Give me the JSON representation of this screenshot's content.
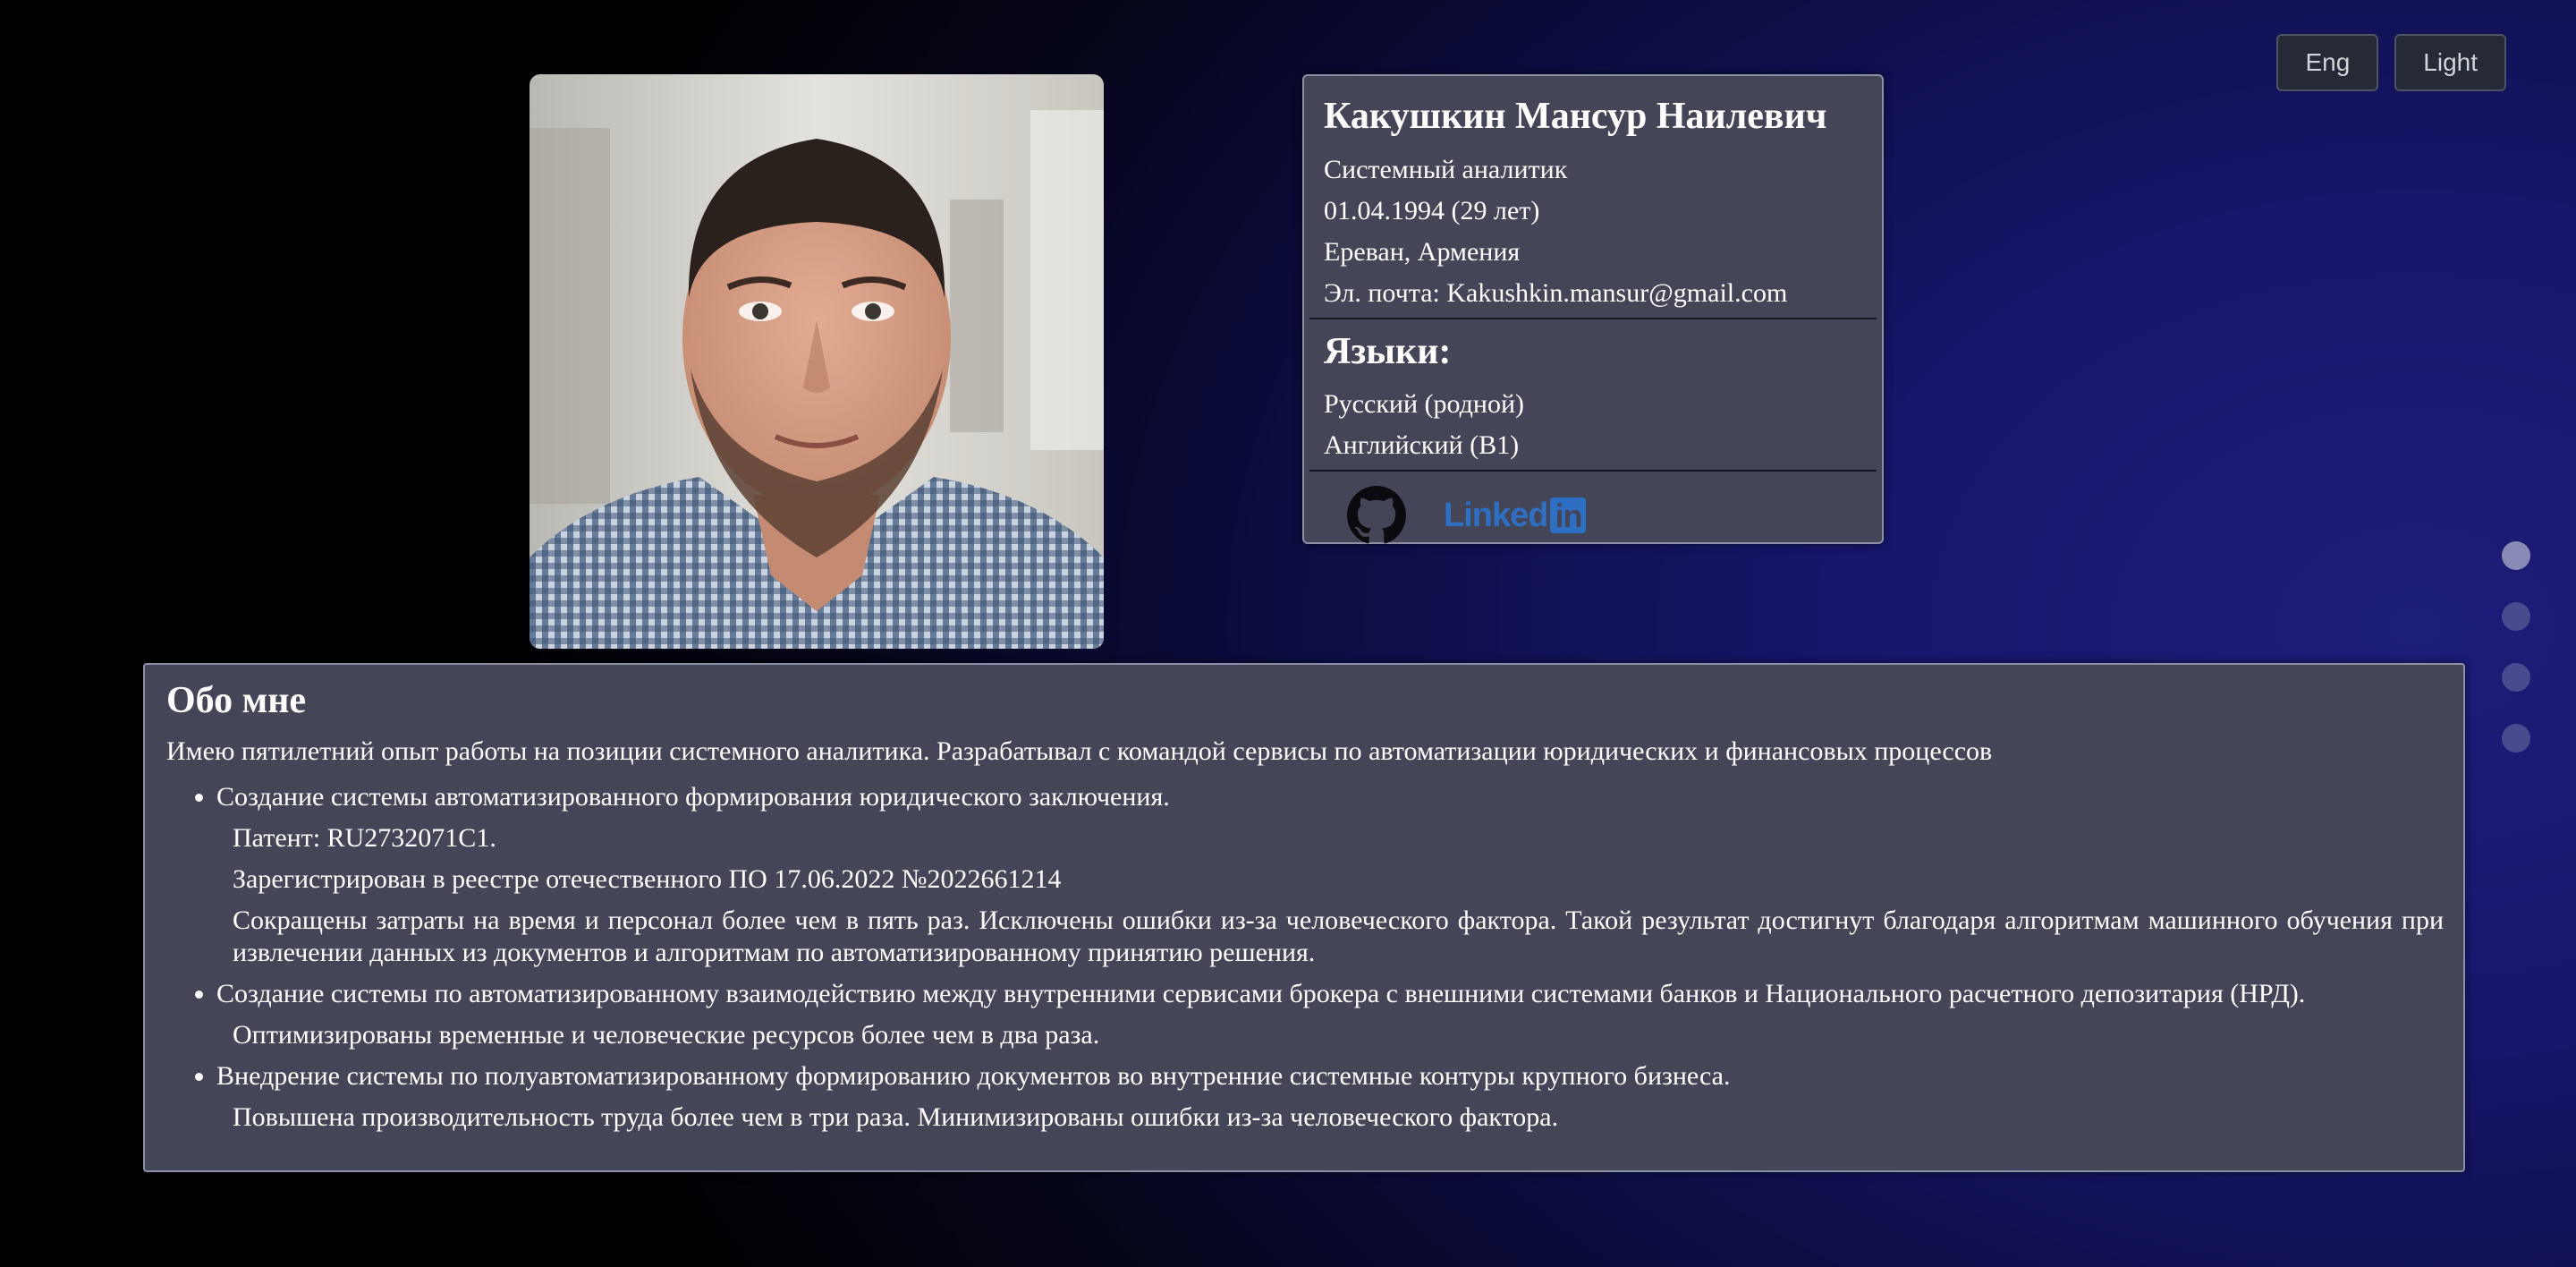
{
  "controls": {
    "lang_button": "Eng",
    "theme_button": "Light"
  },
  "profile": {
    "name": "Какушкин Мансур Наилевич",
    "position": "Системный аналитик",
    "birth": "01.04.1994 (29 лет)",
    "location": "Ереван, Армения",
    "email": "Эл. почта: Kakushkin.mansur@gmail.com",
    "languages_title": "Языки:",
    "languages": [
      "Русский (родной)",
      "Английский (B1)"
    ],
    "socials": {
      "github_icon": "github-icon",
      "linkedin_text": "Linked",
      "linkedin_box": "in"
    }
  },
  "navigation": {
    "dots": 4,
    "active_index": 0
  },
  "about": {
    "title": "Обо мне",
    "intro": "Имею пятилетний опыт работы на позиции системного аналитика. Разрабатывал с командой сервисы по автоматизации юридических и финансовых процессов",
    "items": [
      {
        "text": "Создание системы автоматизированного формирования юридического заключения.",
        "details": [
          "Патент: RU2732071C1.",
          "Зарегистрирован в реестре отечественного ПО 17.06.2022 №2022661214",
          "Сокращены затраты на время и персонал более чем в пять раз. Исключены ошибки из-за человеческого фактора. Такой результат достигнут благодаря алгоритмам машинного обучения при извлечении данных из документов и алгоритмам по автоматизированному принятию решения."
        ]
      },
      {
        "text": "Создание системы по автоматизированному взаимодействию между внутренними сервисами брокера с внешними системами банков и Национального расчетного депозитария (НРД).",
        "details": [
          "Оптимизированы временные и человеческие ресурсов более чем в два раза."
        ]
      },
      {
        "text": "Внедрение системы по полуавтоматизированному формированию документов во внутренние системные контуры крупного бизнеса.",
        "details": [
          "Повышена производительность труда более чем в три раза. Минимизированы ошибки из-за человеческого фактора."
        ]
      }
    ]
  }
}
